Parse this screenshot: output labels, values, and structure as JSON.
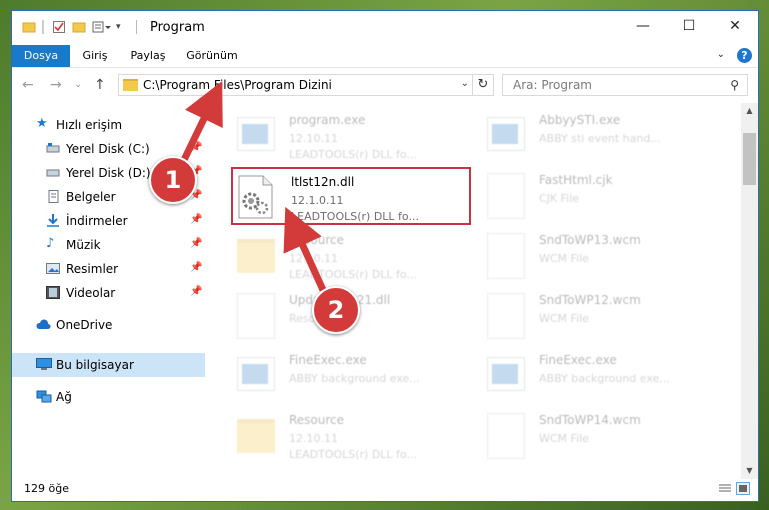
{
  "window": {
    "title": "Program",
    "controls": {
      "minimize": "—",
      "maximize": "☐",
      "close": "✕"
    }
  },
  "ribbon": {
    "tabs": [
      "Dosya",
      "Giriş",
      "Paylaş",
      "Görünüm"
    ],
    "help": "?"
  },
  "nav": {
    "back": "←",
    "forward": "→",
    "recent": "⌄",
    "up": "↑",
    "address": "C:\\Program Files\\Program Dizini",
    "search_placeholder": "Ara: Program"
  },
  "sidebar": {
    "quick_access": "Hızlı erişim",
    "pinned": [
      {
        "label": "Yerel Disk (C:)",
        "icon": "drive-icon"
      },
      {
        "label": "Yerel Disk (D:)",
        "icon": "drive-icon"
      },
      {
        "label": "Belgeler",
        "icon": "documents-icon"
      },
      {
        "label": "İndirmeler",
        "icon": "downloads-icon"
      },
      {
        "label": "Müzik",
        "icon": "music-icon"
      },
      {
        "label": "Resimler",
        "icon": "pictures-icon"
      },
      {
        "label": "Videolar",
        "icon": "videos-icon"
      }
    ],
    "onedrive": "OneDrive",
    "this_pc": "Bu bilgisayar",
    "network": "Ağ"
  },
  "files": [
    {
      "name": "program.exe",
      "line1": "12.10.11",
      "line2": "LEADTOOLS(r) DLL fo...",
      "kind": "exe",
      "state": "faded"
    },
    {
      "name": "AbbyySTI.exe",
      "line1": "ABBY sti event hand...",
      "line2": "",
      "kind": "exe",
      "state": "faded"
    },
    {
      "name": "ltlst12n.dll",
      "line1": "12.1.0.11",
      "line2": "LEADTOOLS(r) DLL fo...",
      "kind": "dll",
      "state": "highlighted"
    },
    {
      "name": "FastHtml.cjk",
      "line1": "CJK File",
      "line2": "",
      "kind": "doc",
      "state": "faded"
    },
    {
      "name": "Resource",
      "line1": "12.10.11",
      "line2": "LEADTOOLS(r) DLL fo...",
      "kind": "folder",
      "state": "faded"
    },
    {
      "name": "SndToWP13.wcm",
      "line1": "WCM File",
      "line2": "",
      "kind": "doc",
      "state": "faded"
    },
    {
      "name": "UpdateSrvt21.dll",
      "line1": "Resource",
      "line2": "",
      "kind": "dll",
      "state": "faded"
    },
    {
      "name": "SndToWP12.wcm",
      "line1": "WCM File",
      "line2": "",
      "kind": "doc",
      "state": "faded"
    },
    {
      "name": "FineExec.exe",
      "line1": "ABBY background exe...",
      "line2": "",
      "kind": "exe",
      "state": "faded"
    },
    {
      "name": "FineExec.exe",
      "line1": "ABBY background exe...",
      "line2": "",
      "kind": "exe",
      "state": "faded"
    },
    {
      "name": "Resource",
      "line1": "12.10.11",
      "line2": "LEADTOOLS(r) DLL fo...",
      "kind": "folder",
      "state": "faded"
    },
    {
      "name": "SndToWP14.wcm",
      "line1": "WCM File",
      "line2": "",
      "kind": "doc",
      "state": "faded"
    }
  ],
  "status": {
    "count": "129 öğe"
  },
  "annotations": {
    "step1": "1",
    "step2": "2",
    "color": "#d33a3a"
  }
}
